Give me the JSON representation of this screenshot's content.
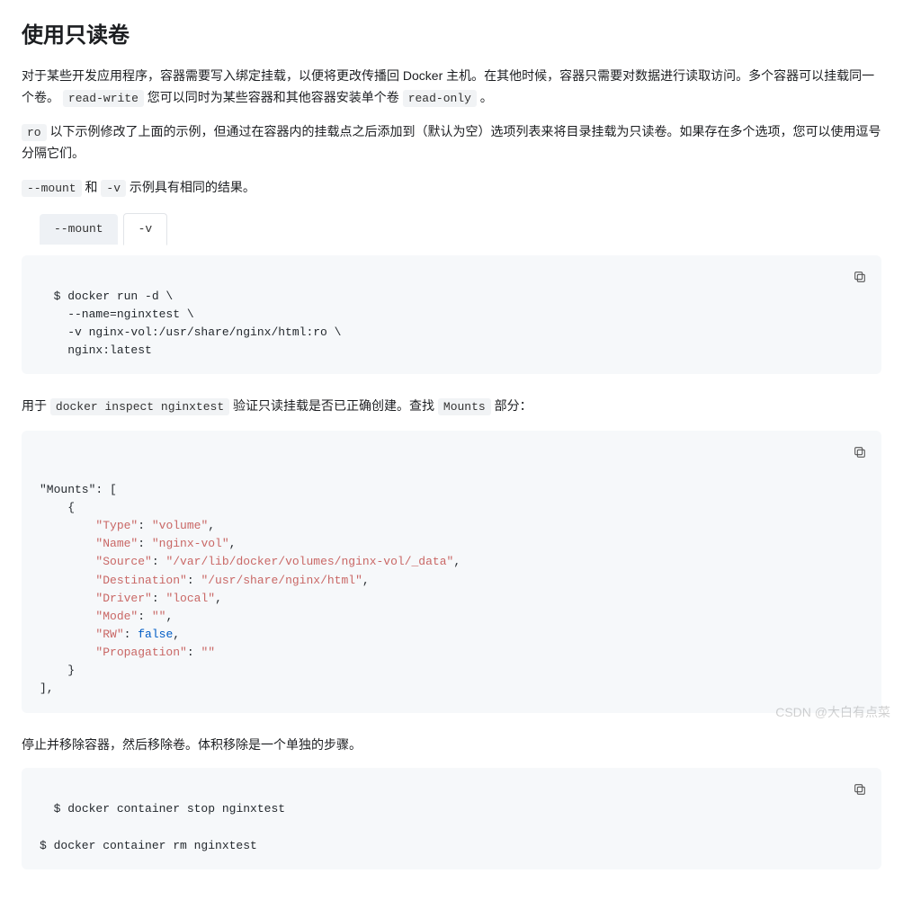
{
  "heading": "使用只读卷",
  "para1": {
    "t1": "对于某些开发应用程序，容器需要写入绑定挂载，以便将更改传播回 Docker 主机。在其他时候，容器只需要对数据进行读取访问。多个容器可以挂载同一个卷。 ",
    "c1": "read-write",
    "t2": " 您可以同时为某些容器和其他容器安装单个卷 ",
    "c2": "read-only",
    "t3": " 。"
  },
  "para2": {
    "c1": "ro",
    "t1": " 以下示例修改了上面的示例，但通过在容器内的挂载点之后添加到（默认为空）选项列表来将目录挂载为只读卷。如果存在多个选项，您可以使用逗号分隔它们。"
  },
  "para3": {
    "c1": "--mount",
    "t1": " 和 ",
    "c2": "-v",
    "t2": " 示例具有相同的结果。"
  },
  "tabs": {
    "tab1": "--mount",
    "tab2": "-v"
  },
  "code1": "$ docker run -d \\\n    --name=nginxtest \\\n    -v nginx-vol:/usr/share/nginx/html:ro \\\n    nginx:latest",
  "para4": {
    "t1": "用于 ",
    "c1": "docker inspect nginxtest",
    "t2": " 验证只读挂载是否已正确创建。查找 ",
    "c2": "Mounts",
    "t3": " 部分："
  },
  "code2": {
    "header": "\"Mounts\": [\n    {",
    "pairs": [
      {
        "k": "\"Type\"",
        "v": "\"volume\"",
        "trail": ","
      },
      {
        "k": "\"Name\"",
        "v": "\"nginx-vol\"",
        "trail": ","
      },
      {
        "k": "\"Source\"",
        "v": "\"/var/lib/docker/volumes/nginx-vol/_data\"",
        "trail": ","
      },
      {
        "k": "\"Destination\"",
        "v": "\"/usr/share/nginx/html\"",
        "trail": ","
      },
      {
        "k": "\"Driver\"",
        "v": "\"local\"",
        "trail": ","
      },
      {
        "k": "\"Mode\"",
        "v": "\"\"",
        "trail": ","
      },
      {
        "k": "\"RW\"",
        "v": "false",
        "trail": ",",
        "bool": true
      },
      {
        "k": "\"Propagation\"",
        "v": "\"\"",
        "trail": ""
      }
    ],
    "footer": "    }\n],"
  },
  "para5": "停止并移除容器，然后移除卷。体积移除是一个单独的步骤。",
  "code3": "$ docker container stop nginxtest\n\n$ docker container rm nginxtest",
  "watermark": "CSDN @大白有点菜"
}
